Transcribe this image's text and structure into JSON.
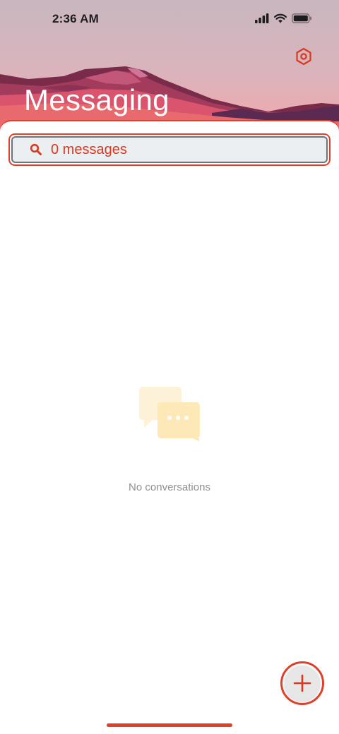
{
  "status_bar": {
    "time": "2:36 AM"
  },
  "header": {
    "title": "Messaging",
    "settings_icon": "settings-hexagon-icon"
  },
  "search": {
    "text": "0 messages",
    "icon": "search-icon"
  },
  "empty_state": {
    "message": "No conversations",
    "icon": "chat-bubbles-icon"
  },
  "fab": {
    "icon": "plus-icon"
  },
  "colors": {
    "accent": "#e0402a",
    "search_bg": "#eceff2",
    "muted_text": "#8f8f8f",
    "illustration": "#fde8b8"
  }
}
